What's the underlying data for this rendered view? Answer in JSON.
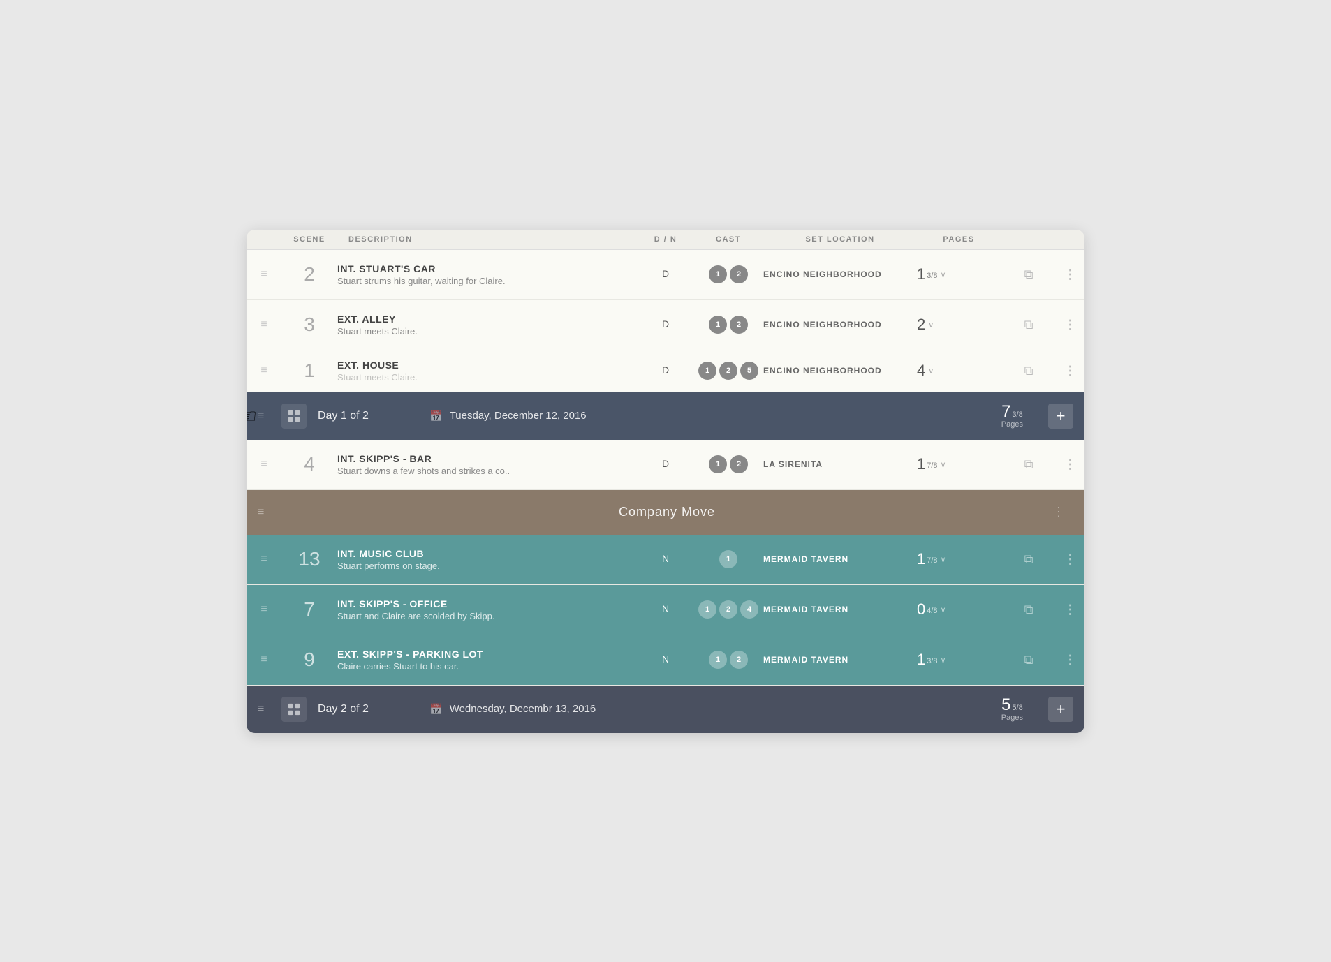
{
  "columns": {
    "scene": "SCENE",
    "description": "DESCRIPTION",
    "dm": "D / N",
    "cast": "CAST",
    "location": "SET LOCATION",
    "pages": "PAGES"
  },
  "day1": {
    "label": "Day 1 of 2",
    "date": "Tuesday, December 12, 2016",
    "pages_num": "7",
    "pages_frac": "3/8",
    "pages_label": "Pages",
    "add_btn": "+"
  },
  "day2": {
    "label": "Day 2 of 2",
    "date": "Wednesday, Decembr 13, 2016",
    "pages_num": "5",
    "pages_frac": "5/8",
    "pages_label": "Pages",
    "add_btn": "+"
  },
  "company_move": {
    "label": "Company Move"
  },
  "scenes": [
    {
      "num": "2",
      "title": "INT. STUART'S CAR",
      "desc": "Stuart strums his guitar, waiting for Claire.",
      "dm": "D",
      "cast": [
        "1",
        "2"
      ],
      "location": "ENCINO NEIGHBORHOOD",
      "pages_main": "1",
      "pages_frac": "3/8",
      "day": "1"
    },
    {
      "num": "3",
      "title": "EXT. ALLEY",
      "desc": "Stuart meets Claire.",
      "dm": "D",
      "cast": [
        "1",
        "2"
      ],
      "location": "ENCINO NEIGHBORHOOD",
      "pages_main": "2",
      "pages_frac": "",
      "day": "1"
    },
    {
      "num": "1",
      "title": "EXT. HOUSE",
      "desc": "Stuart meets Claire.",
      "dm": "D",
      "cast": [
        "1",
        "2",
        "5"
      ],
      "location": "ENCINO NEIGHBORHOOD",
      "pages_main": "4",
      "pages_frac": "",
      "day": "1"
    },
    {
      "num": "4",
      "title": "INT. SKIPP'S - BAR",
      "desc": "Stuart downs a few shots and strikes a co..",
      "dm": "D",
      "cast": [
        "1",
        "2"
      ],
      "location": "LA SIRENITA",
      "pages_main": "1",
      "pages_frac": "7/8",
      "day": "1"
    },
    {
      "num": "13",
      "title": "INT. MUSIC CLUB",
      "desc": "Stuart performs on stage.",
      "dm": "N",
      "cast": [
        "1"
      ],
      "location": "MERMAID TAVERN",
      "pages_main": "1",
      "pages_frac": "7/8",
      "day": "2"
    },
    {
      "num": "7",
      "title": "INT. SKIPP'S - OFFICE",
      "desc": "Stuart and Claire are scolded by Skipp.",
      "dm": "N",
      "cast": [
        "1",
        "2",
        "4"
      ],
      "location": "MERMAID TAVERN",
      "pages_main": "0",
      "pages_frac": "4/8",
      "day": "2"
    },
    {
      "num": "9",
      "title": "EXT. SKIPP'S - PARKING LOT",
      "desc": "Claire carries Stuart to his car.",
      "dm": "N",
      "cast": [
        "1",
        "2"
      ],
      "location": "MERMAID TAVERN",
      "pages_main": "1",
      "pages_frac": "3/8",
      "day": "2"
    }
  ]
}
